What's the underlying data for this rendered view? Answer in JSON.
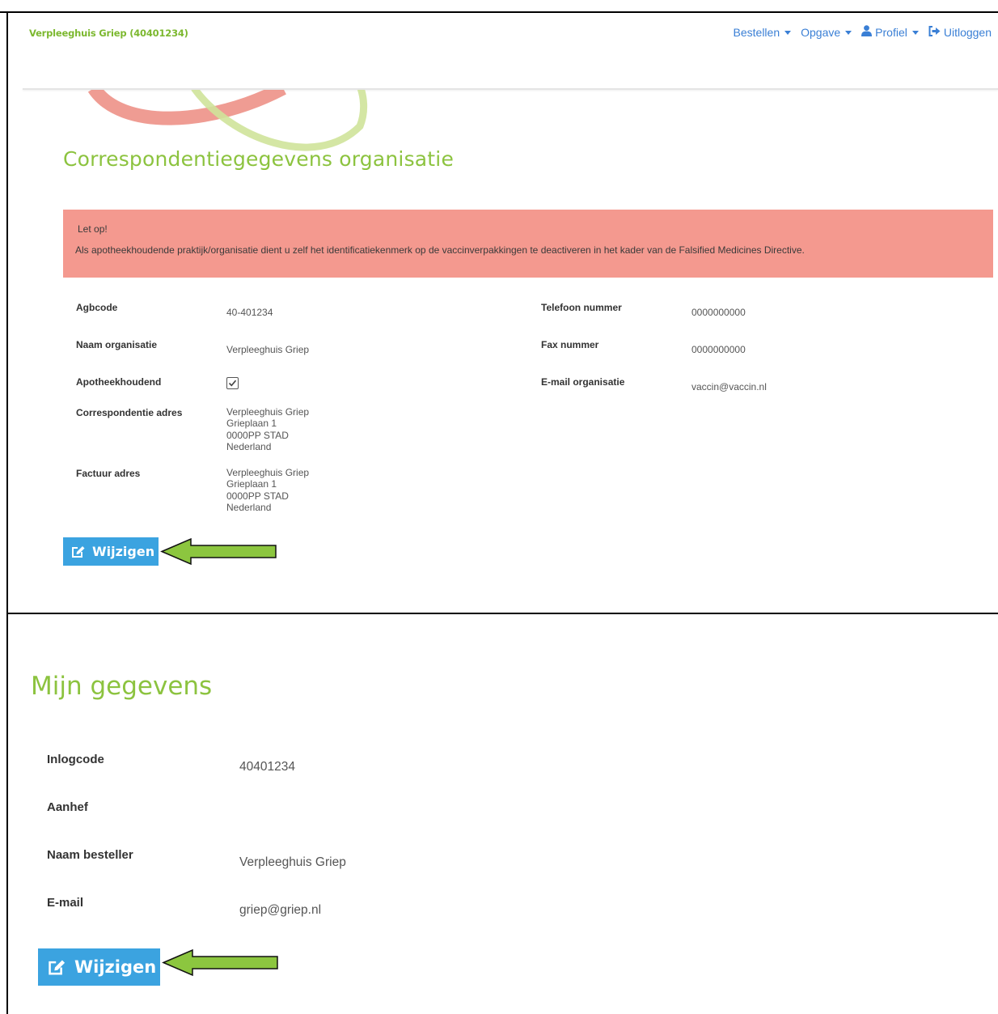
{
  "header": {
    "brand": "Verpleeghuis Griep (40401234)",
    "nav": [
      {
        "label": "Bestellen",
        "icon": "caret-down-icon"
      },
      {
        "label": "Opgave",
        "icon": "caret-down-icon"
      },
      {
        "label": "Profiel",
        "icon": "user-icon"
      },
      {
        "label": "Uitloggen",
        "icon": "sign-out-icon"
      }
    ]
  },
  "organisation": {
    "title": "Correspondentiegegevens organisatie",
    "alert": {
      "title": "Let op!",
      "text": "Als apotheekhoudende praktijk/organisatie dient u zelf het identificatiekenmerk op de vaccinverpakkingen te deactiveren in het kader van de Falsified Medicines Directive."
    },
    "fields": {
      "agbcode": {
        "label": "Agbcode",
        "value": "40-401234"
      },
      "naam": {
        "label": "Naam organisatie",
        "value": "Verpleeghuis Griep"
      },
      "apotheekhoudend": {
        "label": "Apotheekhoudend",
        "checked": true
      },
      "correspondentie_adres": {
        "label": "Correspondentie adres",
        "lines": [
          "Verpleeghuis Griep",
          "Grieplaan 1",
          "0000PP STAD",
          "Nederland"
        ]
      },
      "factuur_adres": {
        "label": "Factuur adres",
        "lines": [
          "Verpleeghuis Griep",
          "Grieplaan 1",
          "0000PP STAD",
          "Nederland"
        ]
      },
      "telefoon": {
        "label": "Telefoon nummer",
        "value": "0000000000"
      },
      "fax": {
        "label": "Fax nummer",
        "value": "0000000000"
      },
      "email": {
        "label": "E-mail organisatie",
        "value": "vaccin@vaccin.nl"
      }
    },
    "edit_button": "Wijzigen"
  },
  "user": {
    "title": "Mijn gegevens",
    "fields": {
      "inlogcode": {
        "label": "Inlogcode",
        "value": "40401234"
      },
      "aanhef": {
        "label": "Aanhef",
        "value": ""
      },
      "naam_besteller": {
        "label": "Naam besteller",
        "value": "Verpleeghuis Griep"
      },
      "email": {
        "label": "E-mail",
        "value": "griep@griep.nl"
      }
    },
    "edit_button": "Wijzigen"
  },
  "colors": {
    "brand_green": "#8cc33f",
    "link_blue": "#3a7fd5",
    "alert_bg": "#f4998f",
    "button_blue": "#3ba3e0",
    "arrow_green": "#8cc63f"
  }
}
